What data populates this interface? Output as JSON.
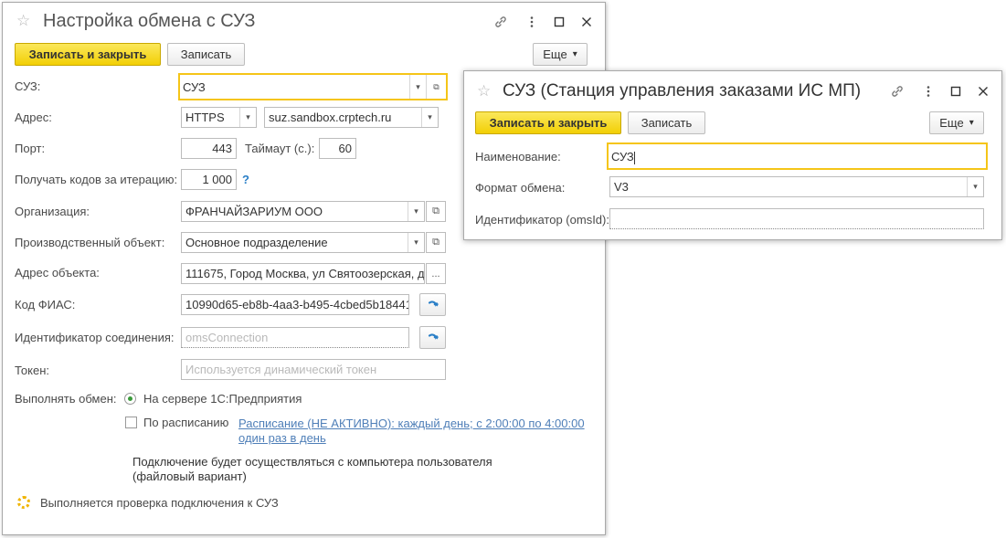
{
  "main_window": {
    "title": "Настройка обмена с СУЗ",
    "toolbar": {
      "save_close": "Записать и закрыть",
      "save": "Записать",
      "more": "Еще"
    },
    "fields": {
      "suz_label": "СУЗ:",
      "suz_value": "СУЗ",
      "address_label": "Адрес:",
      "protocol": "HTTPS",
      "host": "suz.sandbox.crptech.ru",
      "port_label": "Порт:",
      "port": "443",
      "timeout_label": "Таймаут (с.):",
      "timeout": "60",
      "codes_label": "Получать кодов за итерацию:",
      "codes": "1 000",
      "help": "?",
      "org_label": "Организация:",
      "org": "ФРАНЧАЙЗАРИУМ ООО",
      "prod_label": "Производственный объект:",
      "prod": "Основное подразделение",
      "obj_addr_label": "Адрес объекта:",
      "obj_addr": "111675, Город Москва, ул Святоозерская, д",
      "obj_addr_btn": "...",
      "fias_label": "Код ФИАС:",
      "fias": "10990d65-eb8b-4aa3-b495-4cbed5b18441",
      "conn_label": "Идентификатор соединения:",
      "conn_placeholder": "omsConnection",
      "token_label": "Токен:",
      "token_placeholder": "Используется динамический токен"
    },
    "exchange": {
      "label": "Выполнять обмен:",
      "server_option": "На сервере 1С:Предприятия",
      "schedule_option": "По расписанию",
      "schedule_link_line1": "Расписание (НЕ АКТИВНО): каждый день; с 2:00:00 по 4:00:00",
      "schedule_link_line2": "один раз в день",
      "note_line1": "Подключение будет осуществляться с компьютера пользователя",
      "note_line2": "(файловый вариант)"
    },
    "status": "Выполняется проверка подключения к СУЗ"
  },
  "suz_window": {
    "title": "СУЗ (Станция управления заказами ИС МП)",
    "toolbar": {
      "save_close": "Записать и закрыть",
      "save": "Записать",
      "more": "Еще"
    },
    "fields": {
      "name_label": "Наименование:",
      "name": "СУЗ",
      "format_label": "Формат обмена:",
      "format": "V3",
      "oms_label": "Идентификатор (omsId):",
      "oms": ""
    }
  },
  "colors": {
    "primary_button": "#f2cf05",
    "focus_border": "#f5c518",
    "link": "#4f7fb8",
    "help": "#2a7fc7"
  },
  "icons": [
    "star-icon",
    "link-icon",
    "menu-dots-icon",
    "maximize-icon",
    "close-icon",
    "open-form-icon",
    "refresh-arrow-icon",
    "spinner-icon"
  ]
}
